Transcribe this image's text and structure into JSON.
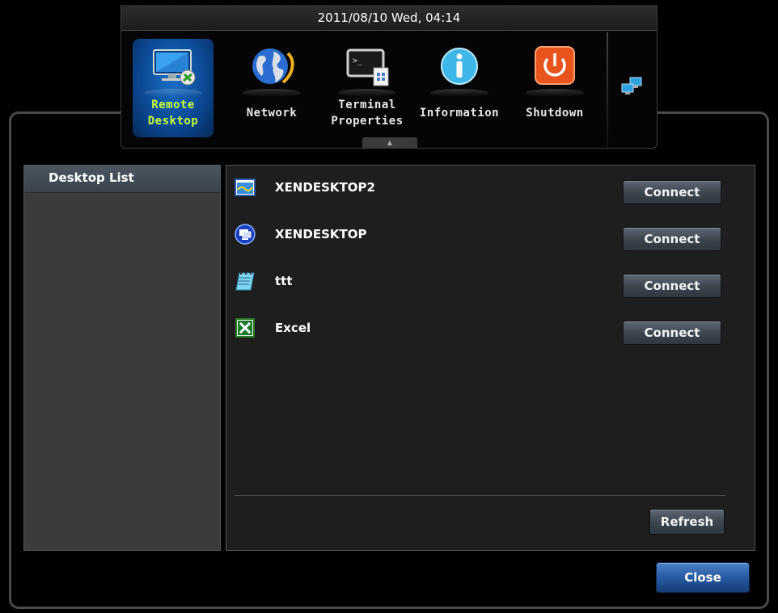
{
  "header": {
    "datetime": "2011/08/10 Wed, 04:14"
  },
  "launcher": {
    "items": [
      {
        "line1": "Remote",
        "line2": "Desktop",
        "icon": "remote-desktop-icon",
        "active": true
      },
      {
        "line1": "Network",
        "line2": "",
        "icon": "globe-icon",
        "active": false
      },
      {
        "line1": "Terminal",
        "line2": "Properties",
        "icon": "terminal-icon",
        "active": false
      },
      {
        "line1": "Information",
        "line2": "",
        "icon": "info-icon",
        "active": false
      },
      {
        "line1": "Shutdown",
        "line2": "",
        "icon": "power-icon",
        "active": false
      }
    ],
    "handle_glyph": "▲",
    "tray_icon": "network-status-icon"
  },
  "left_panel": {
    "title": "Desktop List"
  },
  "desktops": [
    {
      "name": "XENDESKTOP2",
      "icon": "desktop-window-icon",
      "action": "Connect"
    },
    {
      "name": "XENDESKTOP",
      "icon": "remote-pc-icon",
      "action": "Connect"
    },
    {
      "name": "ttt",
      "icon": "notepad-icon",
      "action": "Connect"
    },
    {
      "name": "Excel",
      "icon": "excel-icon",
      "action": "Connect"
    }
  ],
  "footer": {
    "refresh_label": "Refresh",
    "close_label": "Close"
  },
  "colors": {
    "accent_active": "#c8ff3c",
    "active_tile": "#0c4a95",
    "close_button": "#275aa2",
    "power_orange": "#e8541c"
  }
}
